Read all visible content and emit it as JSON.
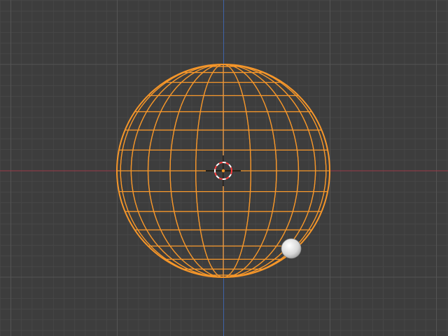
{
  "viewport": {
    "background": "#3d3d3d",
    "grid_minor_color": "#474747",
    "grid_major_color": "#545454",
    "x_axis_color": "#9a3a48",
    "y_axis_color": "#3f63a8"
  },
  "selected_object": {
    "type": "uv-sphere",
    "display": "wireframe",
    "selected": true,
    "wire_color": "#f5962a",
    "rings": 16,
    "segments": 24
  },
  "cursor_3d": {
    "color_a": "#ff3c3c",
    "color_b": "#ffffff"
  },
  "gizmo": {
    "icon": "view-navigation-ball-icon",
    "color": "#e6e6e6"
  }
}
